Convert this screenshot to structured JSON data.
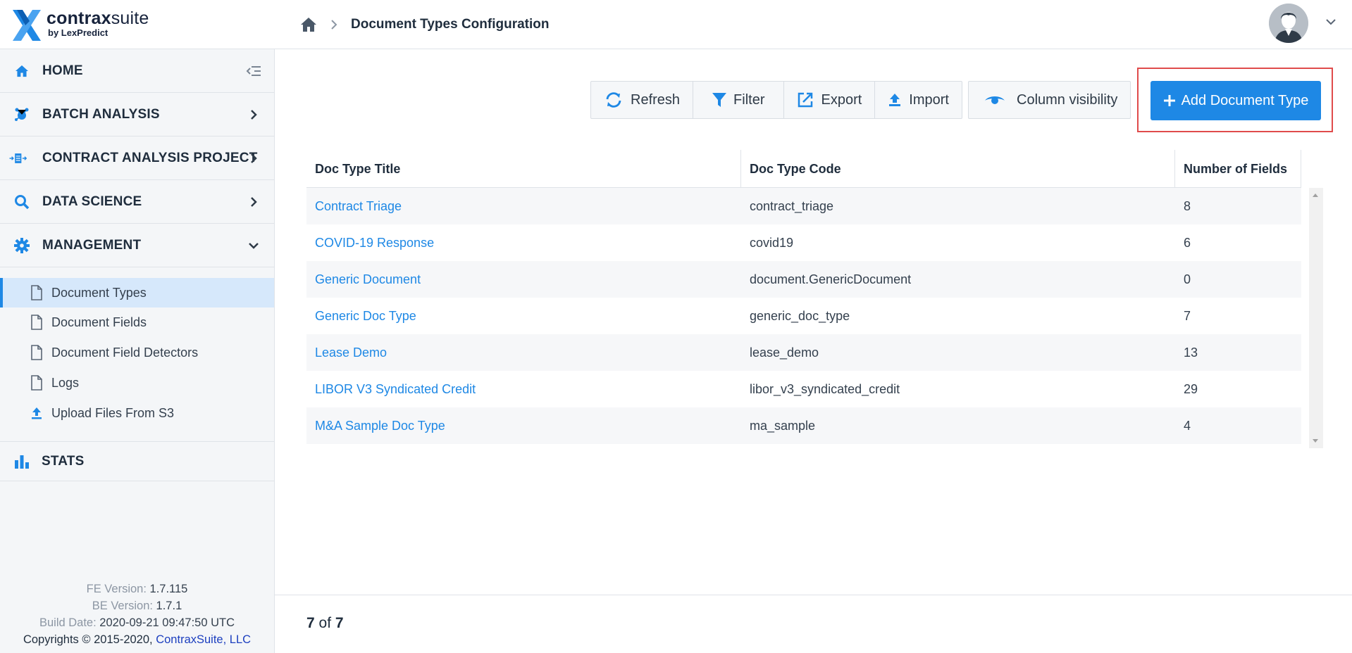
{
  "header": {
    "logo_main": "contrax",
    "logo_main_light": "suite",
    "logo_sub": "by LexPredict",
    "breadcrumb_title": "Document Types Configuration"
  },
  "sidebar": {
    "items": [
      {
        "label": "HOME",
        "icon": "home-icon",
        "right": "collapse-sidebar-icon"
      },
      {
        "label": "BATCH ANALYSIS",
        "icon": "batch-analysis-icon",
        "right": "chevron-right-icon"
      },
      {
        "label": "CONTRACT ANALYSIS PROJECT",
        "icon": "contract-project-icon",
        "right": "chevron-right-icon"
      },
      {
        "label": "DATA SCIENCE",
        "icon": "search-icon",
        "right": "chevron-right-icon"
      },
      {
        "label": "MANAGEMENT",
        "icon": "gear-icon",
        "right": "chevron-down-icon"
      }
    ],
    "sub_items": [
      {
        "label": "Document Types",
        "icon": "document-icon",
        "active": true
      },
      {
        "label": "Document Fields",
        "icon": "document-icon"
      },
      {
        "label": "Document Field Detectors",
        "icon": "document-icon"
      },
      {
        "label": "Logs",
        "icon": "document-icon"
      },
      {
        "label": "Upload Files From S3",
        "icon": "upload-icon"
      }
    ],
    "stats_label": "STATS",
    "footer": {
      "fe_label": "FE Version:",
      "fe_value": "1.7.115",
      "be_label": "BE Version:",
      "be_value": "1.7.1",
      "build_label": "Build Date:",
      "build_value": "2020-09-21 09:47:50 UTC",
      "copyright": "Copyrights © 2015-2020,",
      "company": "ContraxSuite, LLC"
    }
  },
  "toolbar": {
    "refresh": "Refresh",
    "filter": "Filter",
    "export": "Export",
    "import": "Import",
    "column_visibility": "Column visibility",
    "add": "Add Document Type"
  },
  "table": {
    "columns": [
      "Doc Type Title",
      "Doc Type Code",
      "Number of Fields"
    ],
    "rows": [
      {
        "title": "Contract Triage",
        "code": "contract_triage",
        "fields": "8"
      },
      {
        "title": "COVID-19 Response",
        "code": "covid19",
        "fields": "6"
      },
      {
        "title": "Generic Document",
        "code": "document.GenericDocument",
        "fields": "0"
      },
      {
        "title": "Generic Doc Type",
        "code": "generic_doc_type",
        "fields": "7"
      },
      {
        "title": "Lease Demo",
        "code": "lease_demo",
        "fields": "13"
      },
      {
        "title": "LIBOR V3 Syndicated Credit",
        "code": "libor_v3_syndicated_credit",
        "fields": "29"
      },
      {
        "title": "M&A Sample Doc Type",
        "code": "ma_sample",
        "fields": "4"
      }
    ]
  },
  "pager": {
    "shown": "7",
    "of_label": "of",
    "total": "7"
  },
  "colors": {
    "accent": "#1e88e5",
    "highlight": "#e04b4b",
    "sidebar_bg": "#f4f6f8"
  }
}
